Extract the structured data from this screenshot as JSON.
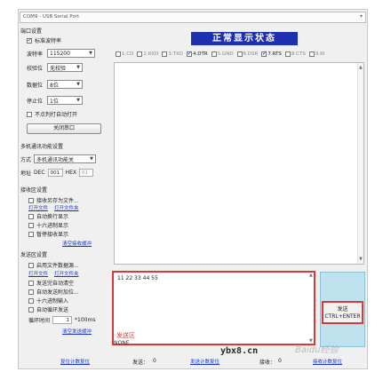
{
  "port_bar": {
    "title": "COM9 - USB Serial Port"
  },
  "serial_settings": {
    "heading": "端口设置",
    "standard_baud_label": "标准波特率",
    "baud_label": "波特率",
    "baud_value": "115200",
    "parity_label": "校验位",
    "parity_value": "无校验",
    "databits_label": "数据位",
    "databits_value": "8位",
    "stopbits_label": "停止位",
    "stopbits_value": "1位",
    "auto_open_label": "不点判打自动打开",
    "close_port_button": "关闭串口"
  },
  "multi_comm": {
    "heading": "多机通讯功能设置",
    "mode_label": "方式",
    "mode_value": "多机通讯功能关",
    "addr_label": "地址",
    "dec_label": "DEC",
    "dec_value": "001",
    "hex_label": "HEX",
    "hex_value": "01"
  },
  "receive_settings": {
    "heading": "接收区设置",
    "save_to_file": "接收另存为文件...",
    "open_file_link": "打开文件",
    "open_folder_link": "打开文件夹",
    "auto_newline": "自动换行显示",
    "hex_display": "十六进制显示",
    "pause_display": "暂停接收显示",
    "clear_rx_link": "清空接收缓冲"
  },
  "send_settings": {
    "heading": "发送区设置",
    "enable_file_source": "启用文件数据源...",
    "open_file_link": "打开文件",
    "open_folder_link": "打开文件夹",
    "auto_clear": "发送完自动清空",
    "auto_append": "自动发送附加位...",
    "hex_input": "十六进制输入",
    "auto_loop": "自动循环发送",
    "loop_period_label": "循环时间",
    "loop_period_value": "1",
    "loop_period_unit": "*100ms",
    "clear_tx_link": "清空发送缓冲"
  },
  "status_title": "正常显示状态",
  "signals": [
    {
      "id": "1",
      "label": "1.CD",
      "checked": false
    },
    {
      "id": "2",
      "label": "2.RXD",
      "checked": false
    },
    {
      "id": "3",
      "label": "3.TXD",
      "checked": false
    },
    {
      "id": "4",
      "label": "4.DTR",
      "checked": true
    },
    {
      "id": "5",
      "label": "5.GND",
      "checked": false
    },
    {
      "id": "6",
      "label": "6.DSR",
      "checked": false
    },
    {
      "id": "7",
      "label": "7.RTS",
      "checked": true
    },
    {
      "id": "8",
      "label": "8.CTS",
      "checked": false
    },
    {
      "id": "9",
      "label": "9.RI",
      "checked": false
    }
  ],
  "send_area": {
    "content": "11 22 33 44 55",
    "label": "发送区",
    "sub_label": "NONE"
  },
  "send_button": {
    "line1": "发送",
    "line2": "CTRL+ENTER"
  },
  "status_bar": {
    "reset_rx_link": "复位计数复位",
    "sent_label": "发送：",
    "sent_count": "0",
    "reset_tx_link": "发送计数复位",
    "received_label": "接收：",
    "received_count": "0",
    "reset_recv_link": "接收计数复位"
  },
  "watermark": {
    "site": "ybx8.cn",
    "brand": "Baidu经验"
  },
  "colors": {
    "accent_blue": "#1e2fb0",
    "highlight_red": "#d83a3a",
    "send_panel": "#bfe2ef",
    "link_blue": "#1a37c8"
  }
}
